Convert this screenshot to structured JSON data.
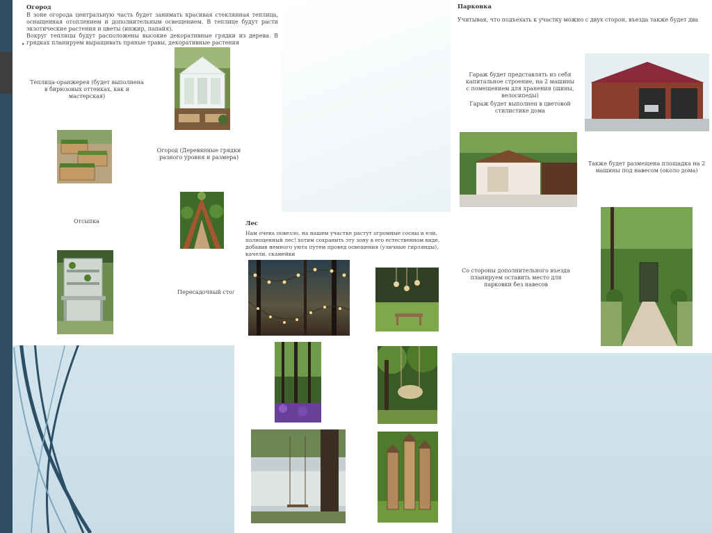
{
  "garden": {
    "heading": "Огород",
    "intro_1": "В зоне огорода центральную часть будет занимать красивая стеклянная теплица, оснащенная отоплением и дополнительным освещением. В теплице будут расти экзотические растения и цветы (инжир, папайя).",
    "intro_2": "Вокруг теплицы будут расположены высокие декоративные грядки из дерева. В грядках планируем выращивать пряные травы, декоративные растения",
    "greenhouse_caption": "Теплица-оранжерея (будет выполнена в бирюзовых оттенках, как и мастерская)",
    "beds_caption": "Огород (Деревянные грядки разного уровня и размера)",
    "seating_caption": "Отсыпка",
    "table_caption": "Пересадочный стол"
  },
  "forest": {
    "heading": "Лес",
    "text": "Нам очень повезло, на нашем участке растут огромные сосны и ели, полноценный лес! хотим сохранить эту зону в его естественном виде, добавив немного уюта путем провед освещения (уличные гирлянды), качели, скамейки"
  },
  "parking": {
    "heading": "Парковка",
    "intro": "Учитывая, что подъехать к участку можно с двух сторон, въезда также будет два",
    "garage_text_1": "Гараж будет представлять из себя капитальное строение, на 2 машины с помещением для хранения (шины, велосипеды)",
    "garage_text_2": "Гараж будет выполнен в цветовой стилистике дома",
    "carport_text": "Также будет размещена площадка на 2 машины под навесом (около дома)",
    "second_entry_text": "Со стороны дополнительного въезда планируем оставить место для парковки без навесов"
  },
  "colors": {
    "sidebar": "#2f4d62",
    "slide_background": "#cfe1ea",
    "deco_line_dark": "#2a4f66",
    "deco_line_light": "#7fa8bd"
  },
  "icons": [
    "bullet-arrow-icon"
  ]
}
